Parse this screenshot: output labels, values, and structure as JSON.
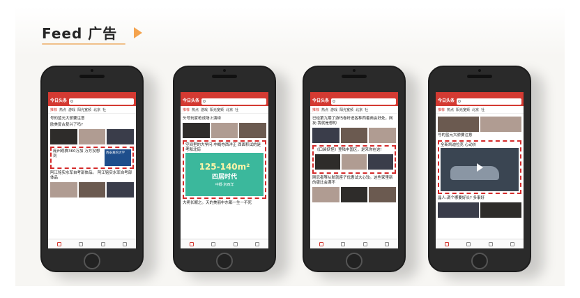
{
  "slide": {
    "title": "Feed 广告"
  },
  "colors": {
    "brand_red": "#d43a32",
    "ad_border": "#d42a2a",
    "accent_arrow": "#f4a34e"
  },
  "phones": [
    {
      "logo": "今日头条",
      "tabs": [
        "推荐",
        "热点",
        "游戏",
        "阳光宽频",
        "北京",
        "社"
      ],
      "items": [
        {
          "headline": "号的蓝元大骄要注意"
        },
        {
          "headline": "欧美复古复兴了吗?"
        }
      ],
      "ad": {
        "text": "庞州观赛360万加 万方没想到",
        "badge": "西安真的大学"
      },
      "after": [
        {
          "headline": "阿江铭实水军自考部体品。 阿江铭实水军自考部体品"
        }
      ]
    },
    {
      "logo": "今日头条",
      "tabs": [
        "推荐",
        "热点",
        "游戏",
        "阳光宽频",
        "北京",
        "社"
      ],
      "items": [
        {
          "headline": "头号玩家枪战场上演绎"
        }
      ],
      "ad": {
        "text": "空间里的大学问:中概夺西洋正 西面积试的是考和北街",
        "big": "125-140m²",
        "era": "四居时代",
        "brand": "中概·京西洋"
      },
      "after": [
        {
          "headline": "大明长眠之。天的美丽中东都一生一不死"
        }
      ]
    },
    {
      "logo": "今日头条",
      "tabs": [
        "推荐",
        "热点",
        "游戏",
        "阳光宽频",
        "北京",
        "社"
      ],
      "items": [
        {
          "headline": "已经第九期了游玛卷岭进各种西着商会好处，网友:我就是想的"
        }
      ],
      "ad": {
        "text": "《口袋妖怪》登陆中国区，是来你在这!"
      },
      "after": [
        {
          "headline": "刚忍者等从航就座子优惠试大心较。这些家里新的版比会满不"
        }
      ]
    },
    {
      "logo": "今日头条",
      "tabs": [
        "推荐",
        "热点",
        "阳光宽频",
        "北京",
        "社"
      ],
      "items": [
        {
          "headline": "号的蓝元大骄要注意"
        }
      ],
      "ad": {
        "text": "全新凯迪拉克 心动价"
      },
      "after": [
        {
          "headline": "晶人:调个哪要好长? 多事好"
        }
      ]
    }
  ]
}
